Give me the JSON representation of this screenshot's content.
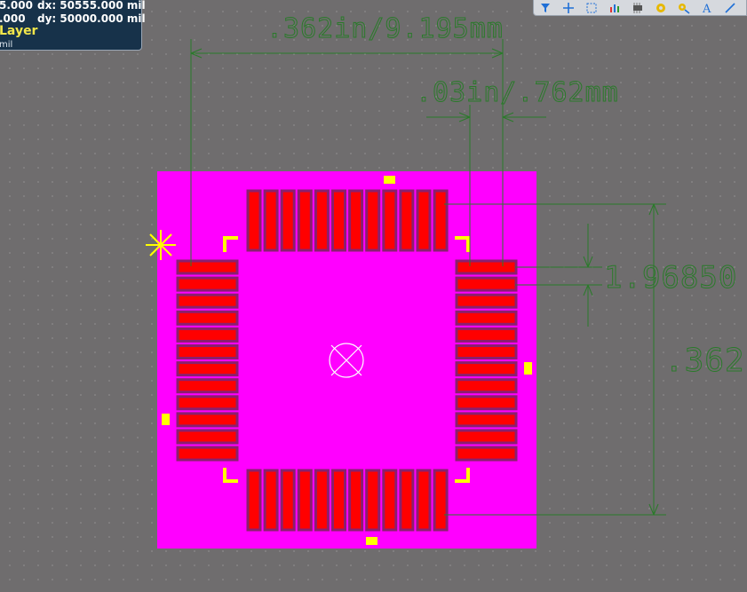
{
  "hud": {
    "row1_left": "5.000",
    "row1_right": "dx: 50555.000 mil",
    "row2_left": ".000",
    "row2_right": "dy: 50000.000  mil",
    "layer": "Layer",
    "unit": "mil"
  },
  "toolbar": {
    "icons": [
      "filter-icon",
      "crosshair-add-icon",
      "select-rect-icon",
      "chart-bars-icon",
      "component-icon",
      "via-circle-icon",
      "pad-key-icon",
      "text-icon",
      "line-icon"
    ]
  },
  "dimensions": {
    "top_width": ".362in/9.195mm",
    "pitch": ".03in/.762mm",
    "pad_width": "1.96850",
    "right_height": ".362"
  },
  "colors": {
    "background": "#6f6d6e",
    "overlay": "#ff00ff",
    "pad": "#ff0000",
    "pad_outline": "#8a1f6e",
    "silk": "#ffff00",
    "dimension": "#2a7a2a",
    "hud_bg": "#17324a"
  },
  "package": {
    "pads_per_side": 12
  }
}
